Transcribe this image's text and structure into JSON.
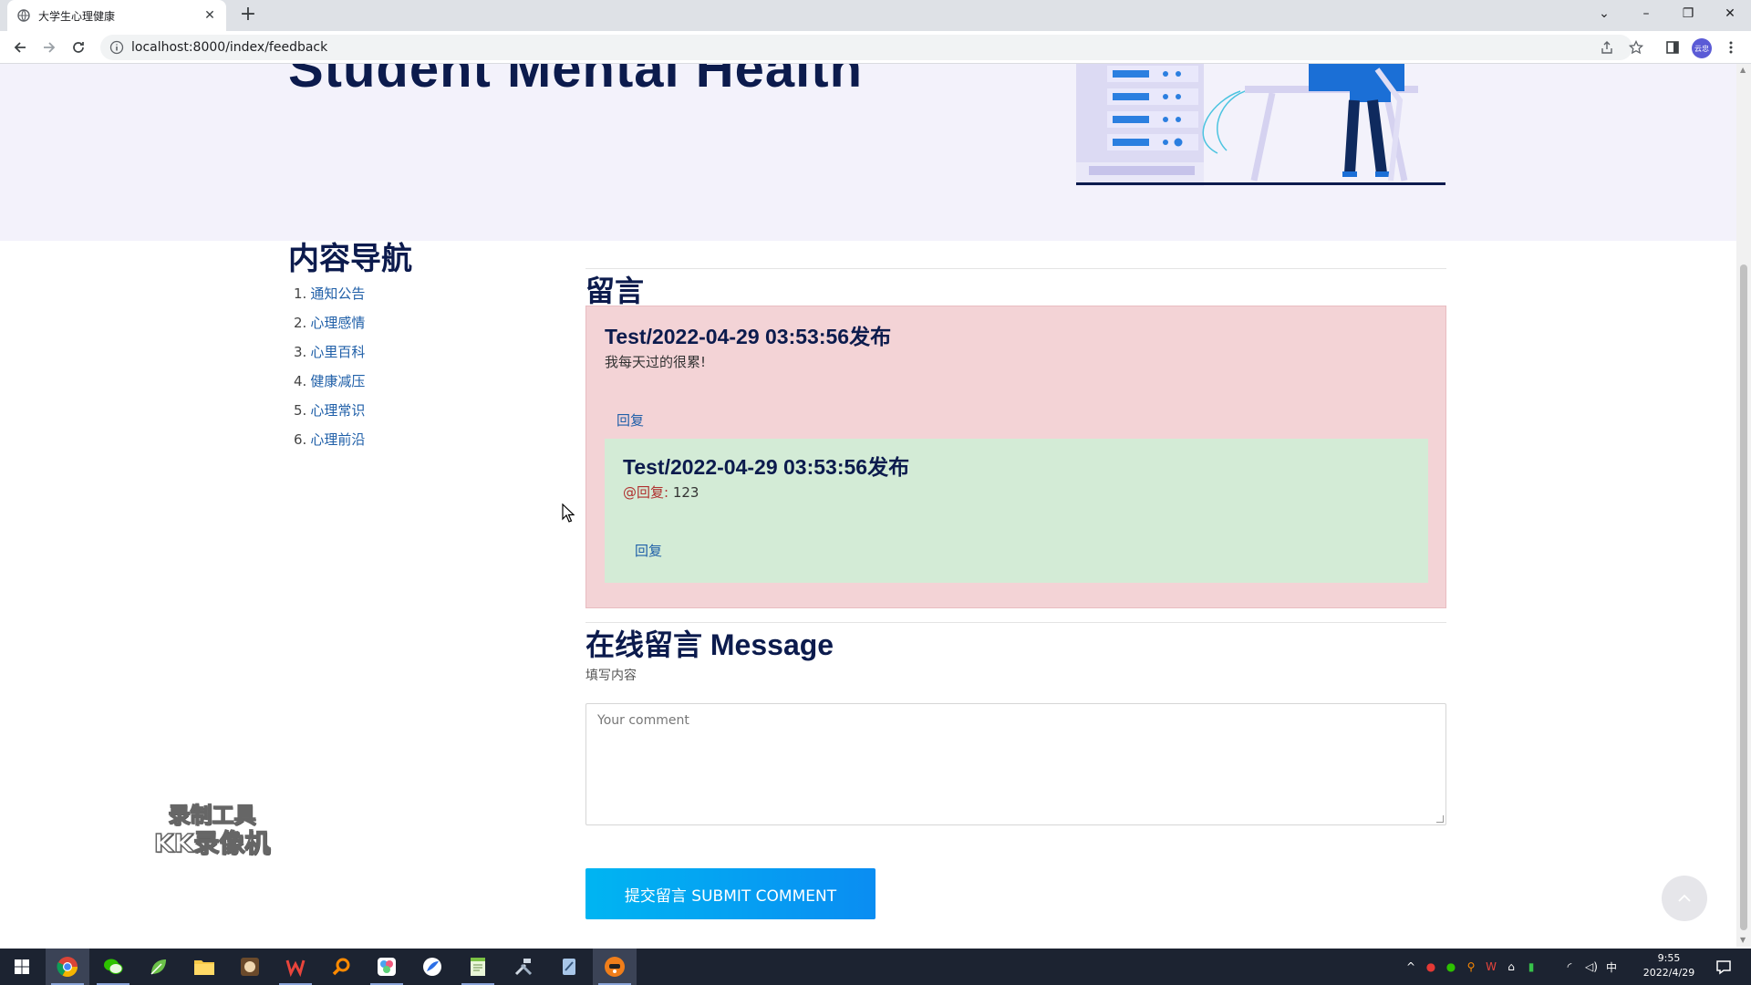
{
  "browser": {
    "tab_title": "大学生心理健康",
    "url": "localhost:8000/index/feedback",
    "profile_label": "云忠"
  },
  "hero": {
    "title": "Student Mental Health"
  },
  "sidebar": {
    "heading": "内容导航",
    "items": [
      {
        "num": "1.",
        "label": "通知公告"
      },
      {
        "num": "2.",
        "label": "心理感情"
      },
      {
        "num": "3.",
        "label": "心里百科"
      },
      {
        "num": "4.",
        "label": "健康减压"
      },
      {
        "num": "5.",
        "label": "心理常识"
      },
      {
        "num": "6.",
        "label": "心理前沿"
      }
    ]
  },
  "messages": {
    "heading": "留言",
    "comment": {
      "header": "Test/2022-04-29 03:53:56发布",
      "body": "我每天过的很累!",
      "reply_label": "回复"
    },
    "reply": {
      "header": "Test/2022-04-29 03:53:56发布",
      "at_label": "@回复:",
      "body": "123",
      "reply_label": "回复"
    }
  },
  "form": {
    "heading": "在线留言 Message",
    "subtitle": "填写内容",
    "placeholder": "Your comment",
    "submit_label": "提交留言 SUBMIT COMMENT"
  },
  "watermark": {
    "line1": "录制工具",
    "line2": "KK录像机"
  },
  "taskbar": {
    "time": "9:55",
    "date": "2022/4/29",
    "ime": "中"
  },
  "colors": {
    "heading_navy": "#0c1b4d",
    "link_blue": "#1f5fa8",
    "comment_bg": "#f3d3d6",
    "reply_bg": "#d3ebd6",
    "submit_bg": "#0aa4f2"
  }
}
